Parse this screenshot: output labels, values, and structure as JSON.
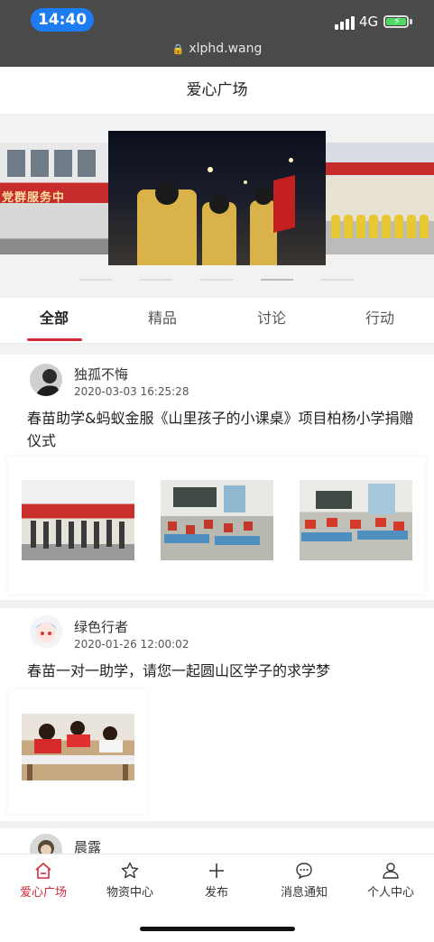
{
  "status": {
    "time": "14:40",
    "network": "4G",
    "url": "xlphd.wang"
  },
  "header": {
    "title": "爱心广场"
  },
  "banner": {
    "left_sign": "党群服务中",
    "slide_count": 5,
    "active_slide": 4
  },
  "tabs": [
    {
      "label": "全部",
      "active": true
    },
    {
      "label": "精品",
      "active": false
    },
    {
      "label": "讨论",
      "active": false
    },
    {
      "label": "行动",
      "active": false
    }
  ],
  "posts": [
    {
      "author": "独孤不悔",
      "date": "2020-03-03 16:25:28",
      "title": "春苗助学&蚂蚁金服《山里孩子的小课桌》项目柏杨小学捐赠仪式",
      "image_count": 3
    },
    {
      "author": "绿色行者",
      "date": "2020-01-26 12:00:02",
      "title": "春苗一对一助学，请您一起圆山区学子的求学梦",
      "image_count": 1
    },
    {
      "author": "晨露"
    }
  ],
  "bottom_nav": [
    {
      "label": "爱心广场",
      "icon": "home-icon",
      "active": true
    },
    {
      "label": "物资中心",
      "icon": "star-icon",
      "active": false
    },
    {
      "label": "发布",
      "icon": "plus-icon",
      "active": false
    },
    {
      "label": "消息通知",
      "icon": "chat-bubble-icon",
      "active": false
    },
    {
      "label": "个人中心",
      "icon": "user-icon",
      "active": false
    }
  ],
  "colors": {
    "accent": "#d32a3a",
    "status_bar": "#4a4a4a",
    "time_pill": "#1e7cf2"
  }
}
